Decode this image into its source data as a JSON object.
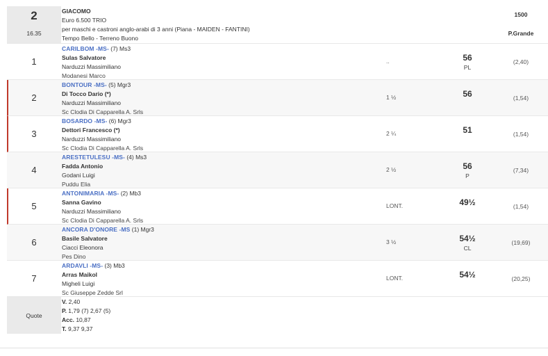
{
  "race": {
    "number": "2",
    "time": "16.35",
    "name": "GIACOMO",
    "prize": "Euro 6.500 TRIO",
    "conditions": "per maschi e castroni anglo-arabi di 3 anni (Piana -  MAIDEN  - FANTINI)",
    "weather": "Tempo Bello - Terreno Buono",
    "distance": "1500",
    "track": "P.Grande"
  },
  "runners": [
    {
      "pos": "1",
      "horse": "CARILBOM -MS-",
      "rest": " (7) Ms3",
      "jockey": "Sulas Salvatore",
      "trainer": "Narduzzi Massimiliano",
      "owner": "Modanesi Marco",
      "dist": "..",
      "weight": "56",
      "weight_flag": "PL",
      "odds": "(2,40)"
    },
    {
      "pos": "2",
      "horse": "BONTOUR -MS-",
      "rest": " (5) Mgr3",
      "jockey": "Di Tocco Dario (*)",
      "trainer": "Narduzzi Massimiliano",
      "owner": "Sc Clodia Di Capparella A. Srls",
      "dist": "1 ½",
      "weight": "56",
      "weight_flag": "",
      "odds": "(1,54)"
    },
    {
      "pos": "3",
      "horse": "BOSARDO -MS-",
      "rest": " (6) Mgr3",
      "jockey": "Dettori Francesco (*)",
      "trainer": "Narduzzi Massimiliano",
      "owner": "Sc Clodia Di Capparella A. Srls",
      "dist": "2 ¼",
      "weight": "51",
      "weight_flag": "",
      "odds": "(1,54)"
    },
    {
      "pos": "4",
      "horse": "ARESTETULESU -MS-",
      "rest": " (4) Ms3",
      "jockey": "Fadda Antonio",
      "trainer": "Godani Luigi",
      "owner": "Puddu Elia",
      "dist": "2 ½",
      "weight": "56",
      "weight_flag": "P",
      "odds": "(7,34)"
    },
    {
      "pos": "5",
      "horse": "ANTONIMARIA -MS-",
      "rest": " (2) Mb3",
      "jockey": "Sanna Gavino",
      "trainer": "Narduzzi Massimiliano",
      "owner": "Sc Clodia Di Capparella A. Srls",
      "dist": "LONT.",
      "weight": "49½",
      "weight_flag": "",
      "odds": "(1,54)"
    },
    {
      "pos": "6",
      "horse": "ANCORA D'ONORE -MS",
      "rest": " (1) Mgr3",
      "jockey": "Basile Salvatore",
      "trainer": "Ciacci Eleonora",
      "owner": "Pes Dino",
      "dist": "3 ½",
      "weight": "54½",
      "weight_flag": "CL",
      "odds": "(19,69)"
    },
    {
      "pos": "7",
      "horse": "ARDAVLI -MS-",
      "rest": " (3) Mb3",
      "jockey": "Arras Maikol",
      "trainer": "Migheli Luigi",
      "owner": "Sc Giuseppe Zedde Srl",
      "dist": "LONT.",
      "weight": "54½",
      "weight_flag": "",
      "odds": "(20,25)"
    }
  ],
  "quote": {
    "label": "Quote",
    "v_label": "V.",
    "v_value": " 2,40",
    "p_label": "P.",
    "p_value": " 1,79 (7)  2,67 (5)",
    "acc_label": "Acc.",
    "acc_value": " 10,87",
    "t_label": "T.",
    "t_value": " 9,37  9,37"
  }
}
